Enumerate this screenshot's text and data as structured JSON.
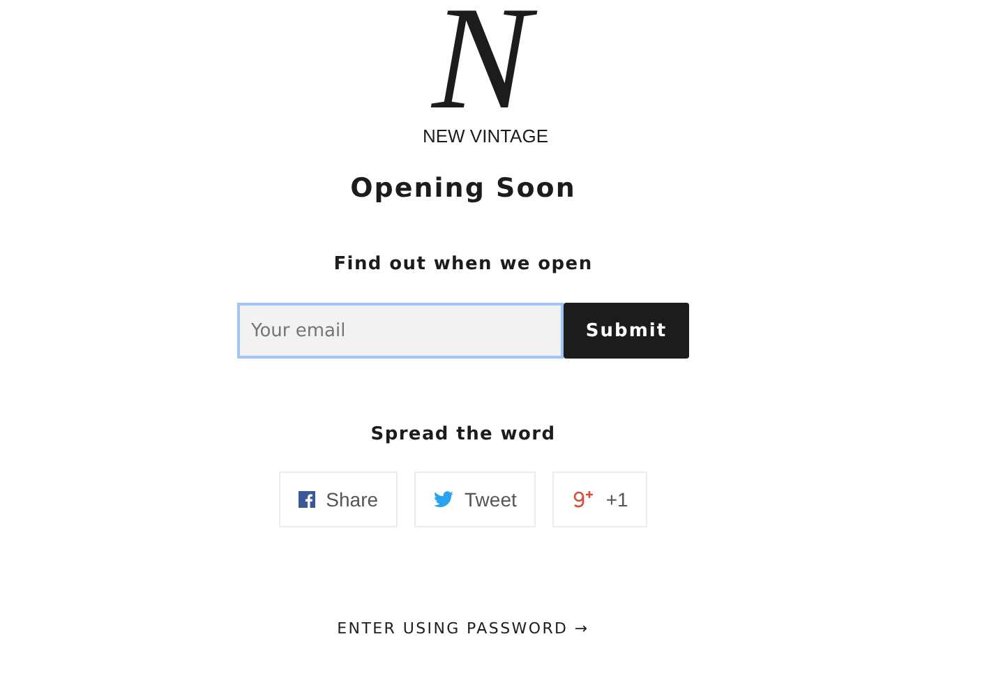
{
  "logo": {
    "letter": "N",
    "name": "NEW VINTAGE"
  },
  "title": "Opening Soon",
  "signup": {
    "heading": "Find out when we open",
    "placeholder": "Your email",
    "focused": true,
    "button": "Submit"
  },
  "share": {
    "heading": "Spread the word",
    "buttons": [
      {
        "kind": "facebook",
        "label": "Share"
      },
      {
        "kind": "twitter",
        "label": "Tweet"
      },
      {
        "kind": "google",
        "label": "+1"
      }
    ]
  },
  "password_link": "ENTER USING PASSWORD →"
}
